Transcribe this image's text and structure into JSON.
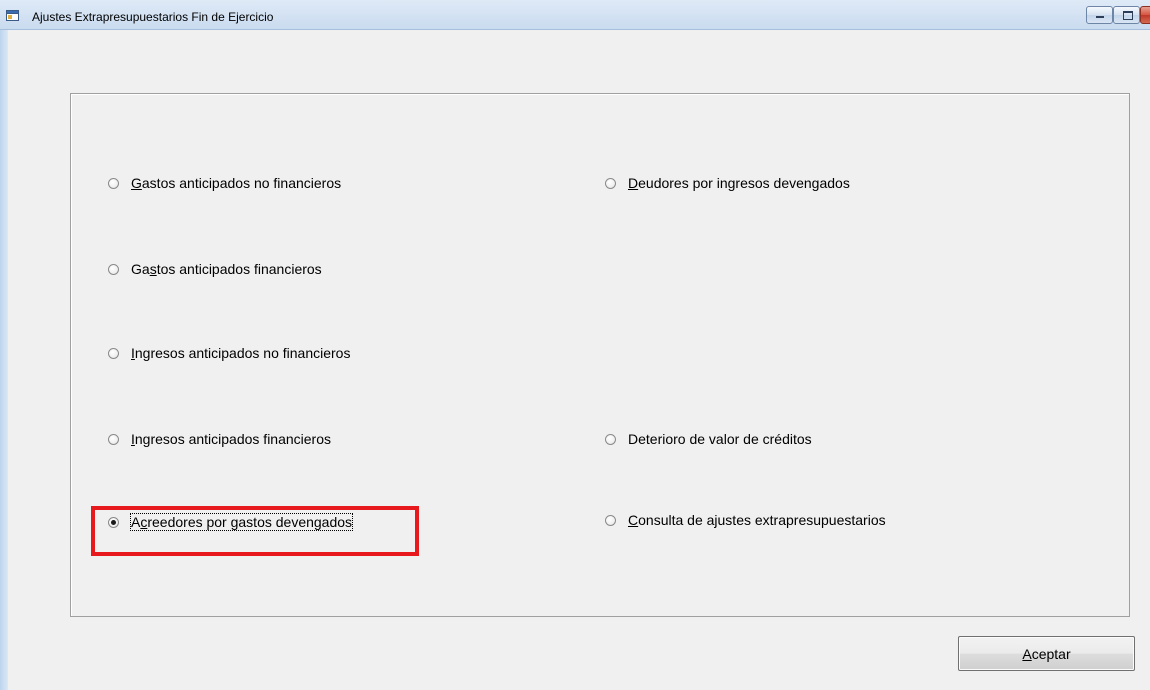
{
  "window": {
    "title": "Ajustes Extrapresupuestarios Fin de Ejercicio"
  },
  "options": [
    {
      "id": "gastos-anticipados-no-financieros",
      "accel": "G",
      "rest": "astos anticipados no financieros",
      "checked": false
    },
    {
      "id": "gastos-anticipados-financieros",
      "pre": "Ga",
      "accel": "s",
      "rest": "tos anticipados financieros",
      "checked": false
    },
    {
      "id": "ingresos-anticipados-no-financieros",
      "accel": "I",
      "rest": "ngresos anticipados no financieros",
      "checked": false
    },
    {
      "id": "ingresos-anticipados-financieros",
      "accel": "I",
      "rest": "ngresos anticipados financieros",
      "checked": false
    },
    {
      "id": "acreedores-por-gastos-devengados",
      "pre": "A",
      "accel": "c",
      "rest": "reedores por gastos devengados",
      "checked": true
    },
    {
      "id": "deudores-por-ingresos-devengados",
      "accel": "D",
      "rest": "eudores por ingresos devengados",
      "checked": false
    },
    {
      "id": "deterioro-de-valor-de-creditos",
      "label": "Deterioro de valor de créditos",
      "checked": false
    },
    {
      "id": "consulta-de-ajustes-extrapresupuestarios",
      "accel": "C",
      "rest": "onsulta de ajustes extrapresupuestarios",
      "checked": false
    }
  ],
  "buttons": {
    "aceptar": {
      "accel": "A",
      "rest": "ceptar"
    }
  },
  "colors": {
    "highlight": "#e8191c",
    "window_bg": "#f0f0f0",
    "titlebar": "#c9dbef"
  }
}
